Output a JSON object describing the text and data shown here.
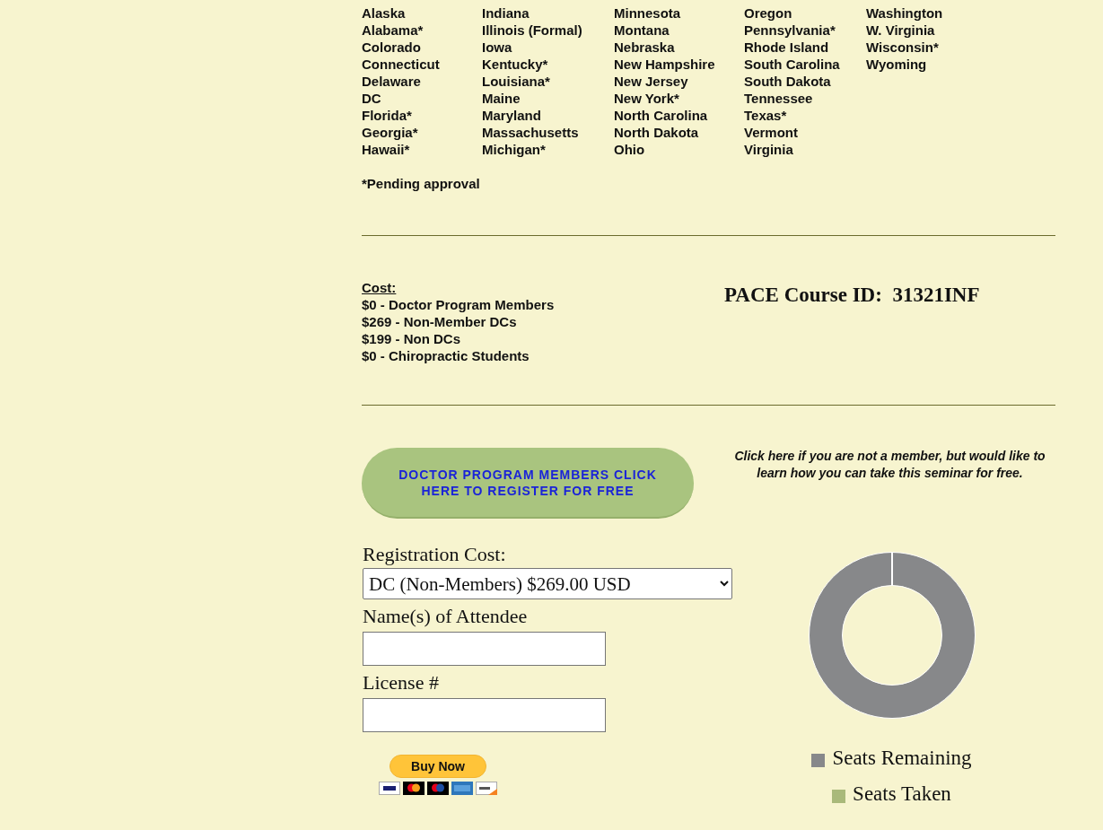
{
  "states_columns": [
    [
      "Alaska",
      "Alabama*",
      "Colorado",
      "Connecticut",
      "Delaware",
      "DC",
      "Florida*",
      "Georgia*",
      "Hawaii*"
    ],
    [
      "Indiana",
      "Illinois (Formal)",
      "Iowa",
      "Kentucky*",
      "Louisiana*",
      "Maine",
      "Maryland",
      "Massachusetts",
      "Michigan*"
    ],
    [
      "Minnesota",
      "Montana",
      "Nebraska",
      "New Hampshire",
      "New Jersey",
      "New York*",
      "North Carolina",
      "North Dakota",
      "Ohio"
    ],
    [
      "Oregon",
      "Pennsylvania*",
      "Rhode Island",
      "South Carolina",
      "South Dakota",
      "Tennessee",
      "Texas*",
      "Vermont",
      "Virginia"
    ],
    [
      "Washington",
      "W. Virginia",
      "Wisconsin*",
      "Wyoming"
    ]
  ],
  "pending_note": "*Pending approval",
  "cost": {
    "heading": "Cost:",
    "lines": [
      "$0 - Doctor Program Members",
      "$269 - Non-Member DCs",
      "$199 - Non DCs",
      "$0 - Chiropractic Students"
    ]
  },
  "pace_course_id": "PACE Course ID:  31321INF",
  "register_button": "DOCTOR PROGRAM MEMBERS CLICK HERE TO REGISTER FOR FREE",
  "non_member_link": "Click here if you are not a member, but would like to learn how you can take this seminar for free.",
  "form": {
    "registration_cost_label": "Registration Cost:",
    "registration_cost_value": "DC (Non-Members) $269.00 USD",
    "attendee_label": "Name(s) of Attendee",
    "license_label": "License #",
    "buy_button": "Buy Now"
  },
  "seats_legend": [
    {
      "label": "Seats Remaining",
      "color": "#87888a"
    },
    {
      "label": "Seats Taken",
      "color": "#a9b97a"
    }
  ]
}
